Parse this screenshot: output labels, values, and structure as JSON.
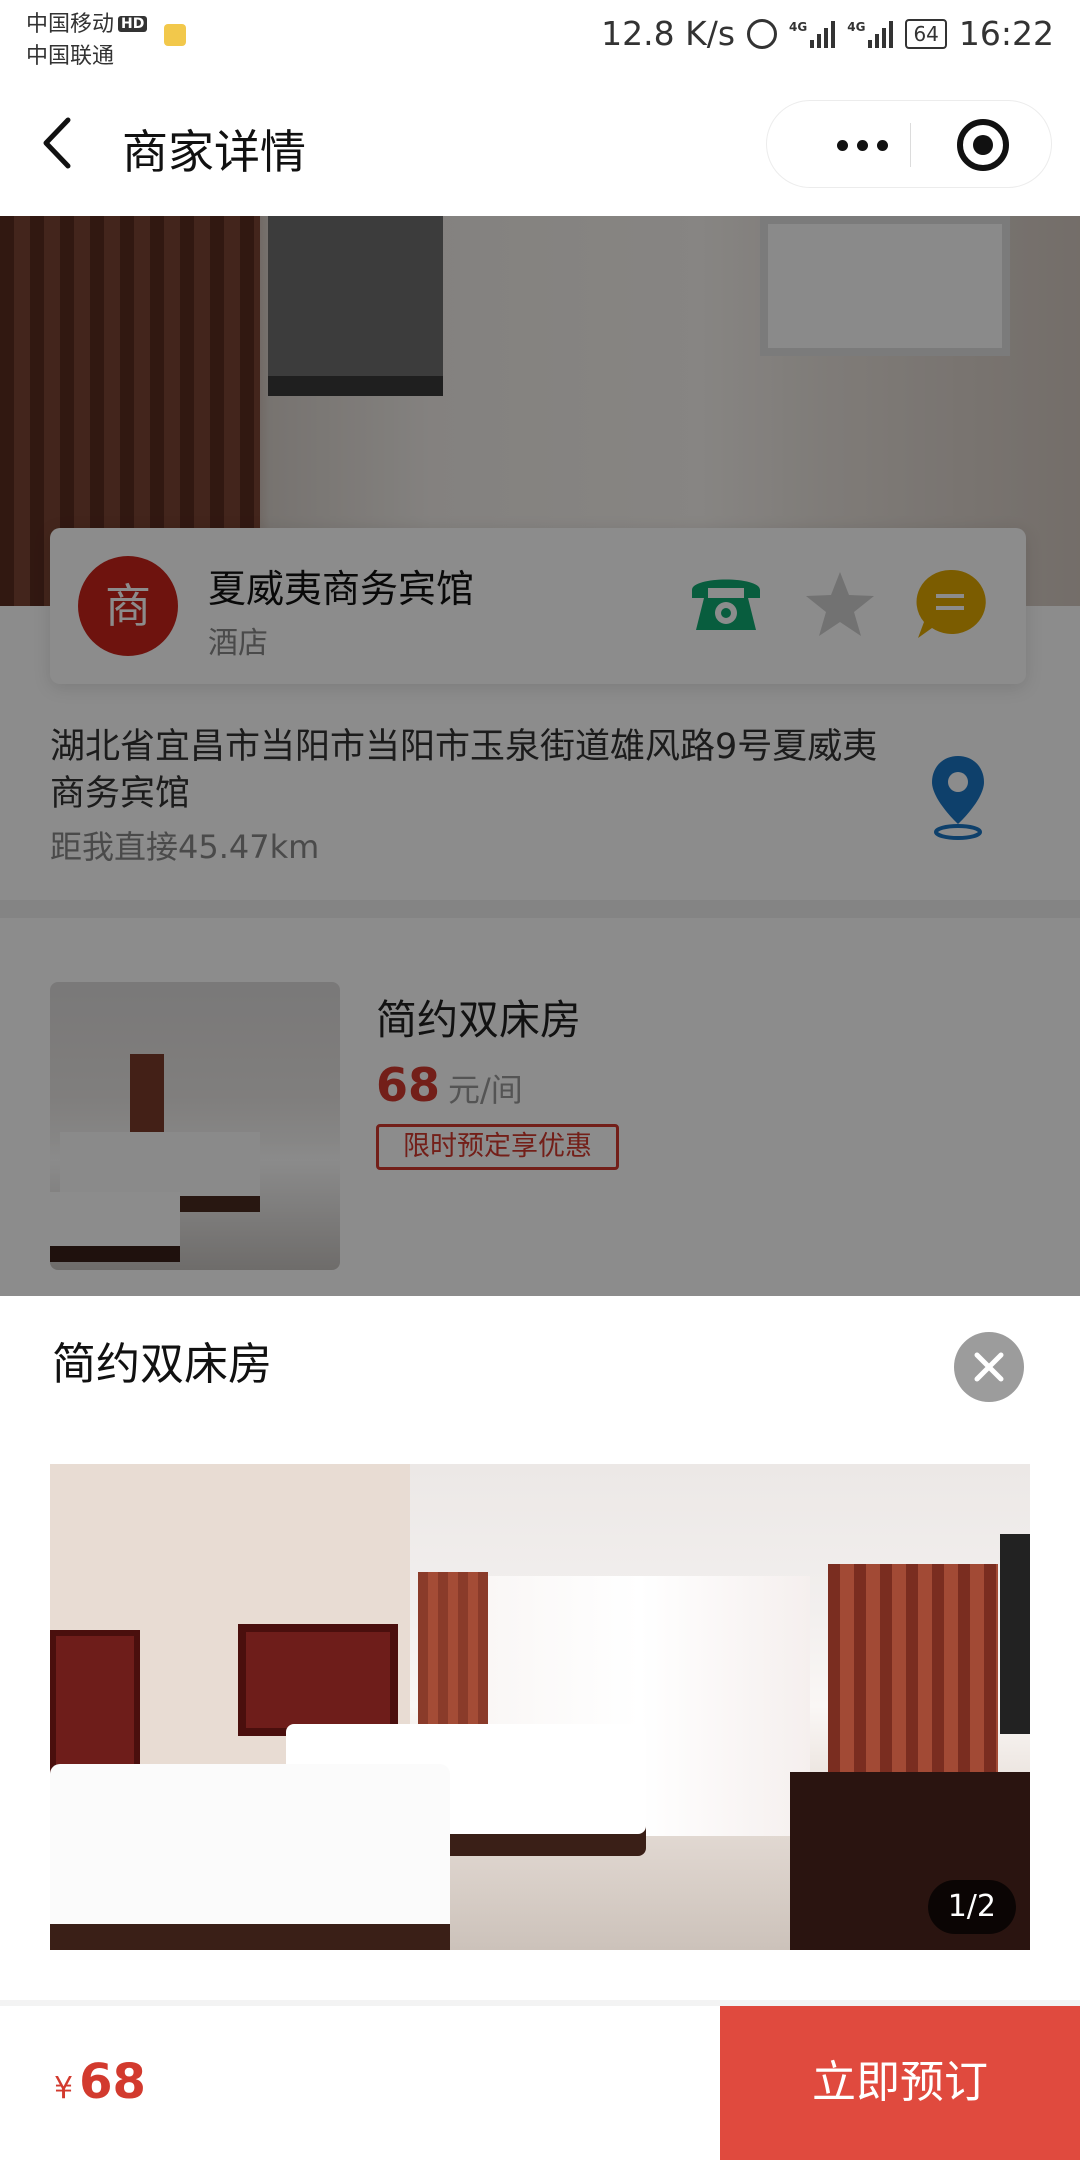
{
  "status_bar": {
    "carrier_1": "中国移动",
    "carrier_1_badge": "HD",
    "carrier_2": "中国联通",
    "network_speed": "12.8 K/s",
    "signal_label_1": "4G",
    "signal_label_2": "4G",
    "battery": "64",
    "time": "16:22"
  },
  "navbar": {
    "title": "商家详情",
    "back_icon": "chevron-left",
    "more_icon": "three-dots",
    "close_icon": "target-circle"
  },
  "shop": {
    "logo_char": "商",
    "logo_color": "#c9241b",
    "name": "夏威夷商务宾馆",
    "category": "酒店",
    "address": "湖北省宜昌市当阳市当阳市玉泉街道雄风路9号夏威夷商务宾馆",
    "distance": "距我直接45.47km",
    "icons": [
      "phone-icon",
      "star-icon",
      "chat-icon",
      "location-pin-icon"
    ]
  },
  "room_list": [
    {
      "name": "简约双床房",
      "price": "68",
      "unit": "元/间",
      "tag": "限时预定享优惠"
    }
  ],
  "sheet": {
    "title": "简约双床房",
    "image_counter": "1/2"
  },
  "footer": {
    "currency": "¥",
    "price": "68",
    "book_button": "立即预订"
  },
  "colors": {
    "accent_red": "#d23a2e",
    "book_button_bg": "#e04a3e",
    "phone_green": "#0fa971",
    "chat_yellow": "#e0a800",
    "pin_blue": "#1b76c4"
  }
}
